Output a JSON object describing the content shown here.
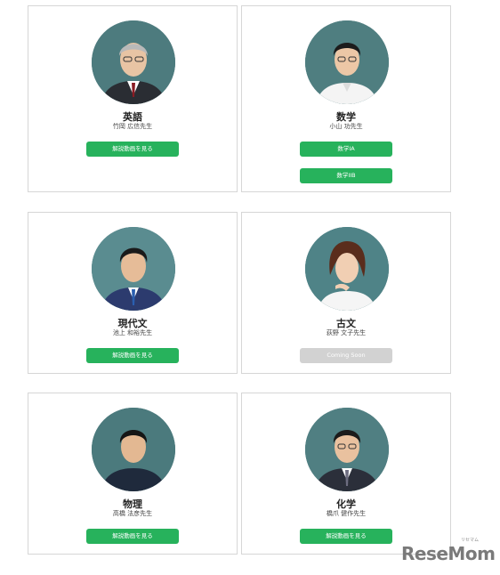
{
  "teachers": [
    {
      "subject": "英語",
      "name": "竹岡 広信先生",
      "buttons": [
        {
          "label": "解説動画を見る",
          "enabled": true
        }
      ]
    },
    {
      "subject": "数学",
      "name": "小山 功先生",
      "buttons": [
        {
          "label": "数学IA",
          "enabled": true
        },
        {
          "label": "数学IIB",
          "enabled": true
        }
      ]
    },
    {
      "subject": "現代文",
      "name": "池上 和裕先生",
      "buttons": [
        {
          "label": "解説動画を見る",
          "enabled": true
        }
      ]
    },
    {
      "subject": "古文",
      "name": "荻野 文子先生",
      "buttons": [
        {
          "label": "Coming Soon",
          "enabled": false
        }
      ]
    },
    {
      "subject": "物理",
      "name": "高橋 法彦先生",
      "buttons": [
        {
          "label": "解説動画を見る",
          "enabled": true
        }
      ]
    },
    {
      "subject": "化学",
      "name": "橋爪 健作先生",
      "buttons": [
        {
          "label": "解説動画を見る",
          "enabled": true
        }
      ]
    }
  ],
  "watermark": {
    "text": "ReseMom",
    "ruby": "リセマム"
  },
  "colors": {
    "button_green": "#27b25c",
    "button_disabled": "#d2d2d2",
    "avatar_bg": "#3e6a6d"
  }
}
